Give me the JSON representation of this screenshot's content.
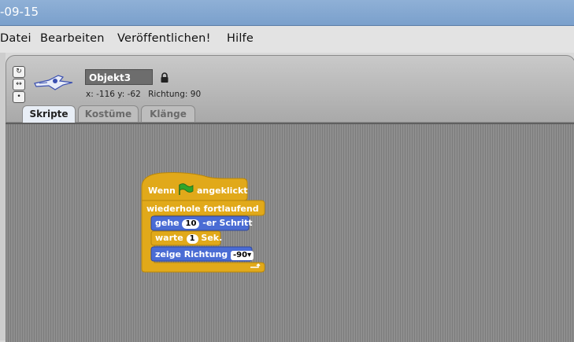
{
  "window": {
    "title_fragment": "-09-15"
  },
  "menu": [
    "Datei",
    "Bearbeiten",
    "Veröffentlichen!",
    "Hilfe"
  ],
  "sprite": {
    "name": "Objekt3",
    "x_label": "x:",
    "x": "-116",
    "y_label": "y:",
    "y": "-62",
    "direction_label": "Richtung:",
    "direction": "90"
  },
  "tabs": [
    {
      "label": "Skripte",
      "active": true
    },
    {
      "label": "Kostüme",
      "active": false
    },
    {
      "label": "Klänge",
      "active": false
    }
  ],
  "script": {
    "hat_prefix": "Wenn",
    "hat_suffix": "angeklickt",
    "forever": "wiederhole fortlaufend",
    "move_prefix": "gehe",
    "move_steps": "10",
    "move_suffix": "-er Schritt",
    "wait_prefix": "warte",
    "wait_secs": "1",
    "wait_suffix": "Sek.",
    "point_label": "zeige Richtung",
    "point_value": "-90"
  },
  "colors": {
    "control": "#e1a91a",
    "motion": "#4a6cd4",
    "flag": "#2fa52a"
  }
}
